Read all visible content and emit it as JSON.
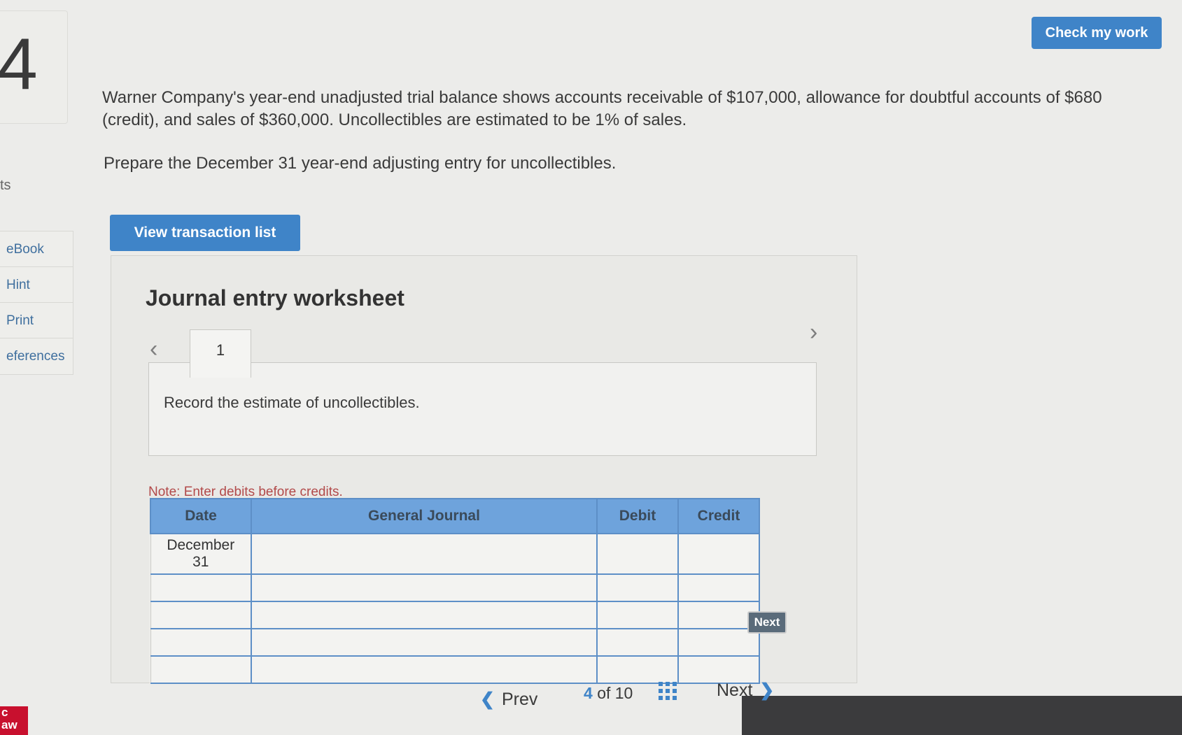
{
  "question": {
    "number": "4",
    "points_label": "ts"
  },
  "rail": {
    "items": [
      {
        "label": "eBook"
      },
      {
        "label": "Hint"
      },
      {
        "label": "Print"
      },
      {
        "label": "eferences"
      }
    ],
    "brand": "c\naw"
  },
  "header": {
    "check_label": "Check my work"
  },
  "problem": {
    "text": "Warner Company's year-end unadjusted trial balance shows accounts receivable of $107,000, allowance for doubtful accounts of $680 (credit), and sales of $360,000. Uncollectibles are estimated to be 1% of sales.",
    "prompt": "Prepare the December 31 year-end adjusting entry for uncollectibles."
  },
  "view_btn_label": "View transaction list",
  "worksheet": {
    "title": "Journal entry worksheet",
    "tab_label": "1",
    "description": "Record the estimate of uncollectibles.",
    "note": "Note: Enter debits before credits.",
    "columns": {
      "date": "Date",
      "journal": "General Journal",
      "debit": "Debit",
      "credit": "Credit"
    },
    "first_date": "December\n31",
    "next_label": "Next"
  },
  "footer": {
    "prev_label": "Prev",
    "current_page": "4",
    "of_text": "of 10",
    "next_label": "Next"
  },
  "colors": {
    "accent": "#3f84c8",
    "table_header": "#6ea3dc",
    "note_red": "#b24a4a"
  }
}
